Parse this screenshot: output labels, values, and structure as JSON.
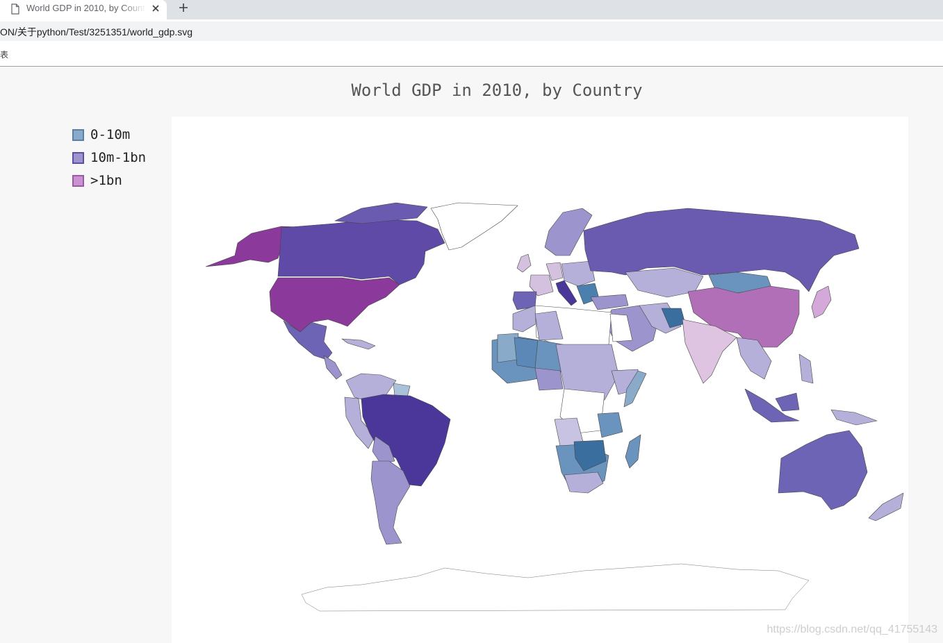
{
  "browser": {
    "tab_title": "World GDP in 2010, by Country",
    "address": "ON/关于python/Test/3251351/world_gdp.svg",
    "bookmark_fragment": "表"
  },
  "chart_data": {
    "type": "choropleth-map",
    "title": "World GDP in 2010, by Country",
    "legend": [
      {
        "label": "0-10m",
        "fill": "#8aaac9",
        "stroke": "#5b7fa6"
      },
      {
        "label": "10m-1bn",
        "fill": "#9c94cc",
        "stroke": "#5c4ea3"
      },
      {
        "label": ">1bn",
        "fill": "#c893cf",
        "stroke": "#9a5aa6"
      }
    ],
    "legend_placement": "top-left",
    "background": "#f7f7f7",
    "plot_background": "#ffffff"
  },
  "watermark": "https://blog.csdn.net/qq_41755143"
}
